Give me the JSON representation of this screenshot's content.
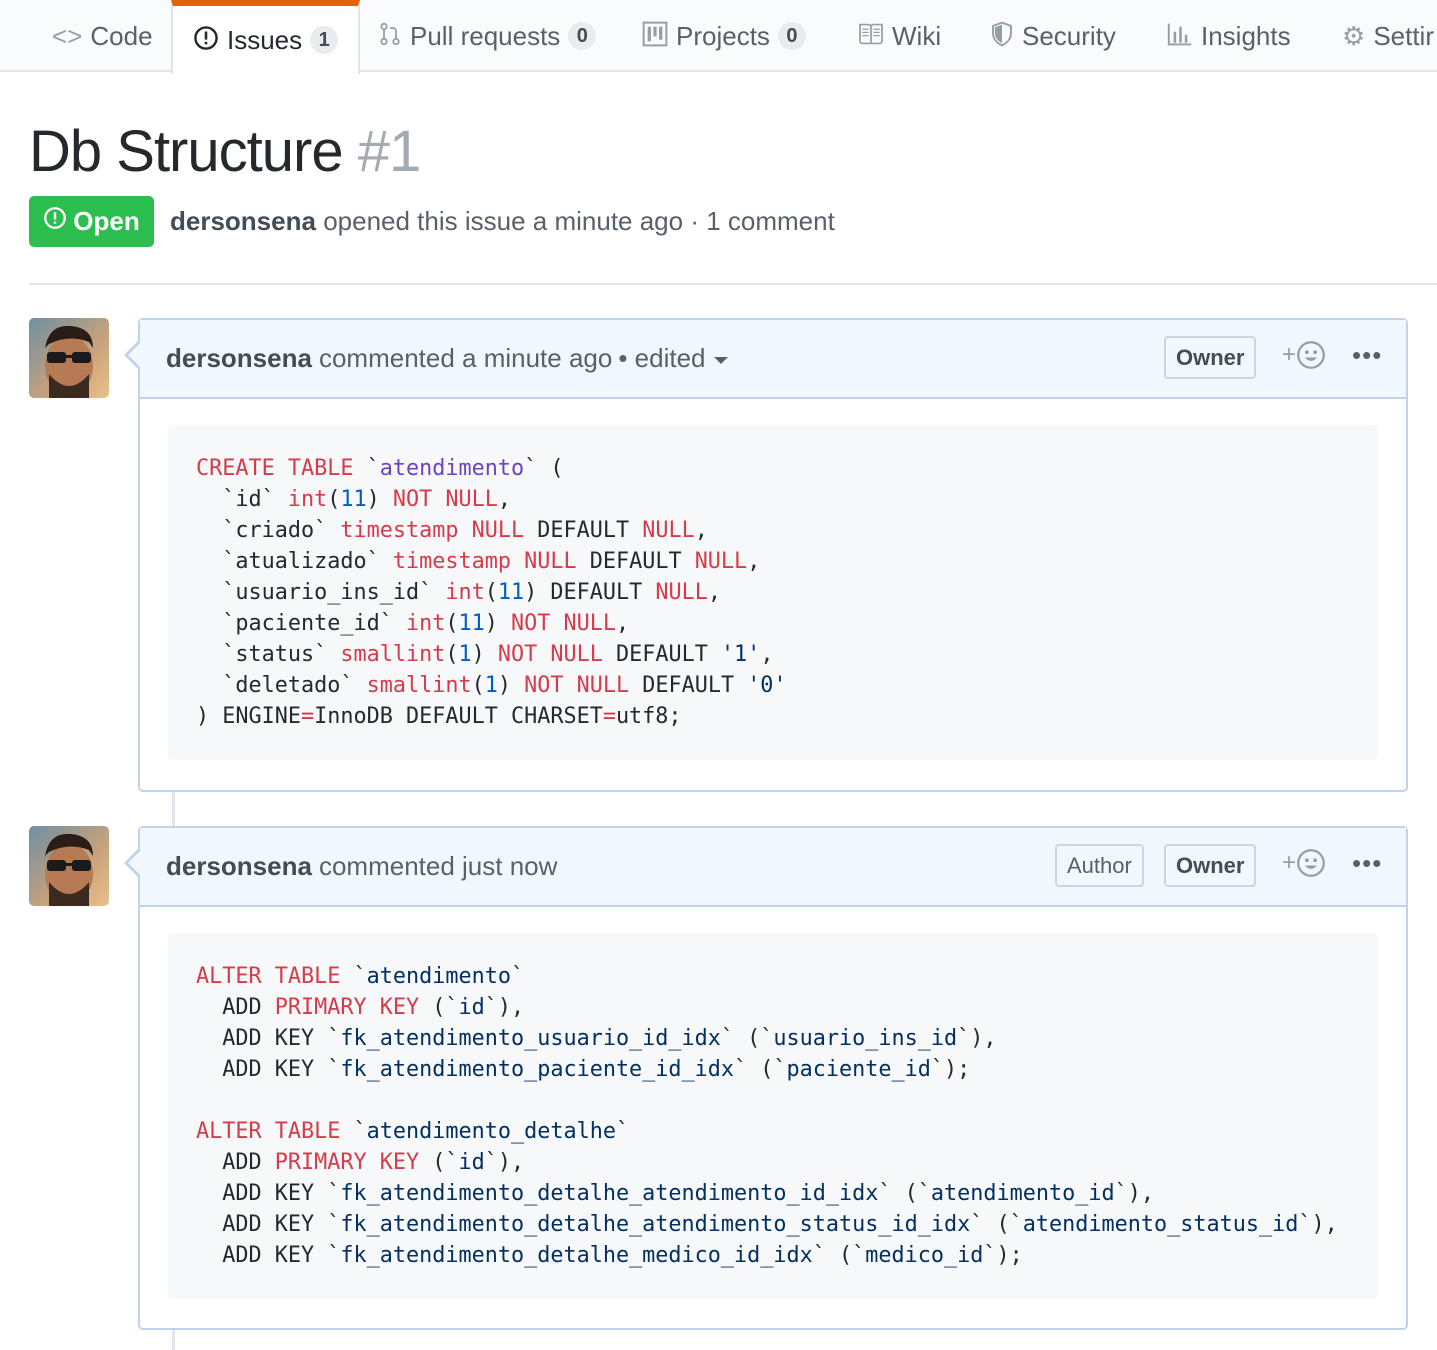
{
  "tabs": [
    {
      "label": "Code",
      "icon": "code-icon",
      "count": null
    },
    {
      "label": "Issues",
      "icon": "issue-opened-icon",
      "count": "1"
    },
    {
      "label": "Pull requests",
      "icon": "git-pull-request-icon",
      "count": "0"
    },
    {
      "label": "Projects",
      "icon": "project-icon",
      "count": "0"
    },
    {
      "label": "Wiki",
      "icon": "book-icon",
      "count": null
    },
    {
      "label": "Security",
      "icon": "shield-icon",
      "count": null
    },
    {
      "label": "Insights",
      "icon": "graph-icon",
      "count": null
    },
    {
      "label": "Settir",
      "icon": "gear-icon",
      "count": null
    }
  ],
  "issue": {
    "title": "Db Structure",
    "number": "#1",
    "state": "Open",
    "author": "dersonsena",
    "opened_text": "opened this issue a minute ago · 1 comment"
  },
  "comments": [
    {
      "author": "dersonsena",
      "action": "commented a minute ago",
      "edited": "• edited",
      "labels": [
        "Owner"
      ],
      "reaction": "+",
      "more": "•••",
      "code": [
        [
          [
            "k",
            "CREATE TABLE"
          ],
          [
            "p",
            " `"
          ],
          [
            "e",
            "atendimento"
          ],
          [
            "p",
            "` ("
          ]
        ],
        [
          [
            "p",
            "  `id` "
          ],
          [
            "k",
            "int"
          ],
          [
            "p",
            "("
          ],
          [
            "n",
            "11"
          ],
          [
            "p",
            ") "
          ],
          [
            "k",
            "NOT NULL"
          ],
          [
            "p",
            ","
          ]
        ],
        [
          [
            "p",
            "  `criado` "
          ],
          [
            "k",
            "timestamp NULL"
          ],
          [
            "p",
            " DEFAULT "
          ],
          [
            "k",
            "NULL"
          ],
          [
            "p",
            ","
          ]
        ],
        [
          [
            "p",
            "  `atualizado` "
          ],
          [
            "k",
            "timestamp NULL"
          ],
          [
            "p",
            " DEFAULT "
          ],
          [
            "k",
            "NULL"
          ],
          [
            "p",
            ","
          ]
        ],
        [
          [
            "p",
            "  `usuario_ins_id` "
          ],
          [
            "k",
            "int"
          ],
          [
            "p",
            "("
          ],
          [
            "n",
            "11"
          ],
          [
            "p",
            ") DEFAULT "
          ],
          [
            "k",
            "NULL"
          ],
          [
            "p",
            ","
          ]
        ],
        [
          [
            "p",
            "  `paciente_id` "
          ],
          [
            "k",
            "int"
          ],
          [
            "p",
            "("
          ],
          [
            "n",
            "11"
          ],
          [
            "p",
            ") "
          ],
          [
            "k",
            "NOT NULL"
          ],
          [
            "p",
            ","
          ]
        ],
        [
          [
            "p",
            "  `status` "
          ],
          [
            "k",
            "smallint"
          ],
          [
            "p",
            "("
          ],
          [
            "n",
            "1"
          ],
          [
            "p",
            ") "
          ],
          [
            "k",
            "NOT NULL"
          ],
          [
            "p",
            " DEFAULT "
          ],
          [
            "s",
            "'1'"
          ],
          [
            "p",
            ","
          ]
        ],
        [
          [
            "p",
            "  `deletado` "
          ],
          [
            "k",
            "smallint"
          ],
          [
            "p",
            "("
          ],
          [
            "n",
            "1"
          ],
          [
            "p",
            ") "
          ],
          [
            "k",
            "NOT NULL"
          ],
          [
            "p",
            " DEFAULT "
          ],
          [
            "s",
            "'0'"
          ]
        ],
        [
          [
            "p",
            ") ENGINE"
          ],
          [
            "k",
            "="
          ],
          [
            "p",
            "InnoDB DEFAULT CHARSET"
          ],
          [
            "k",
            "="
          ],
          [
            "p",
            "utf8;"
          ]
        ]
      ]
    },
    {
      "author": "dersonsena",
      "action": "commented just now",
      "edited": "",
      "labels": [
        "Author",
        "Owner"
      ],
      "reaction": "+",
      "more": "•••",
      "code": [
        [
          [
            "k",
            "ALTER"
          ],
          [
            "p",
            " "
          ],
          [
            "k",
            "TABLE"
          ],
          [
            "p",
            " `"
          ],
          [
            "s",
            "atendimento"
          ],
          [
            "p",
            "`"
          ]
        ],
        [
          [
            "p",
            "  ADD "
          ],
          [
            "k",
            "PRIMARY KEY"
          ],
          [
            "p",
            " (`"
          ],
          [
            "s",
            "id"
          ],
          [
            "p",
            "`),"
          ]
        ],
        [
          [
            "p",
            "  ADD KEY `"
          ],
          [
            "s",
            "fk_atendimento_usuario_id_idx"
          ],
          [
            "p",
            "` (`"
          ],
          [
            "s",
            "usuario_ins_id"
          ],
          [
            "p",
            "`),"
          ]
        ],
        [
          [
            "p",
            "  ADD KEY `"
          ],
          [
            "s",
            "fk_atendimento_paciente_id_idx"
          ],
          [
            "p",
            "` (`"
          ],
          [
            "s",
            "paciente_id"
          ],
          [
            "p",
            "`);"
          ]
        ],
        [
          [
            "p",
            ""
          ]
        ],
        [
          [
            "k",
            "ALTER"
          ],
          [
            "p",
            " "
          ],
          [
            "k",
            "TABLE"
          ],
          [
            "p",
            " `"
          ],
          [
            "s",
            "atendimento_detalhe"
          ],
          [
            "p",
            "`"
          ]
        ],
        [
          [
            "p",
            "  ADD "
          ],
          [
            "k",
            "PRIMARY KEY"
          ],
          [
            "p",
            " (`"
          ],
          [
            "s",
            "id"
          ],
          [
            "p",
            "`),"
          ]
        ],
        [
          [
            "p",
            "  ADD KEY `"
          ],
          [
            "s",
            "fk_atendimento_detalhe_atendimento_id_idx"
          ],
          [
            "p",
            "` (`"
          ],
          [
            "s",
            "atendimento_id"
          ],
          [
            "p",
            "`),"
          ]
        ],
        [
          [
            "p",
            "  ADD KEY `"
          ],
          [
            "s",
            "fk_atendimento_detalhe_atendimento_status_id_idx"
          ],
          [
            "p",
            "` (`"
          ],
          [
            "s",
            "atendimento_status_id"
          ],
          [
            "p",
            "`),"
          ]
        ],
        [
          [
            "p",
            "  ADD KEY `"
          ],
          [
            "s",
            "fk_atendimento_detalhe_medico_id_idx"
          ],
          [
            "p",
            "` (`"
          ],
          [
            "s",
            "medico_id"
          ],
          [
            "p",
            "`);"
          ]
        ]
      ]
    }
  ]
}
